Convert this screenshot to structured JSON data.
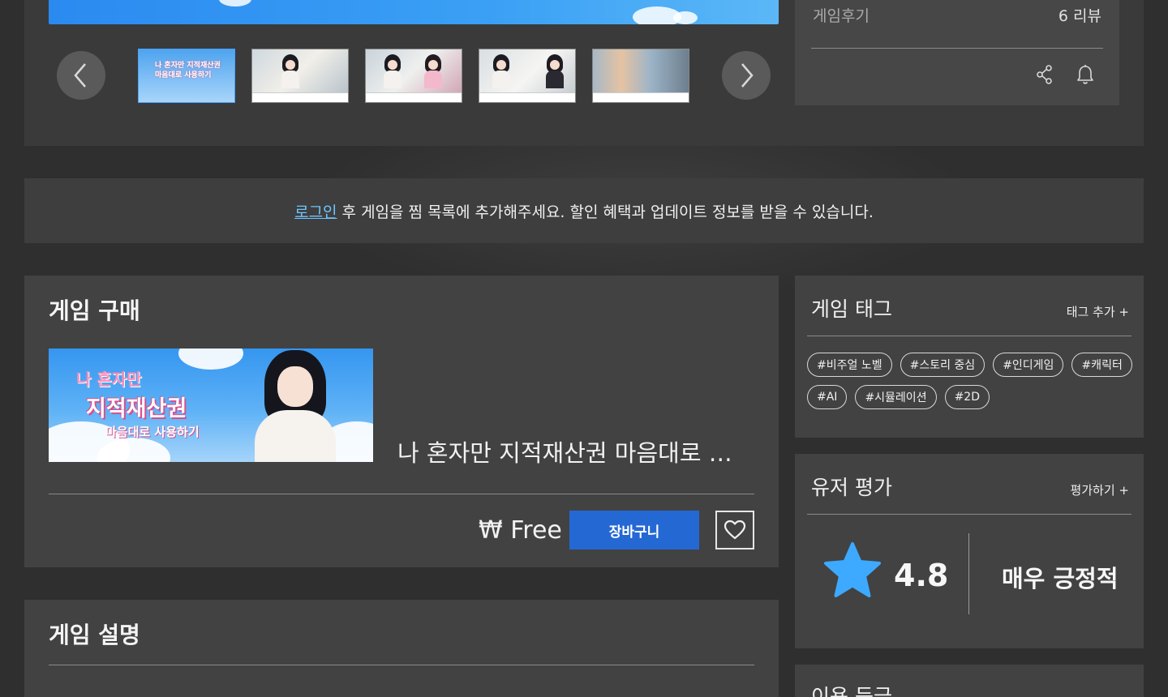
{
  "gallery": {
    "prev_icon": "chevron-left-icon",
    "next_icon": "chevron-right-icon",
    "prev_glyph": "‹",
    "next_glyph": "›",
    "thumbnails": [
      {
        "caption": "나 혼자만 지적재산권 마음대로 사용하기"
      },
      {
        "caption": "room-scene"
      },
      {
        "caption": "two-girls-scene"
      },
      {
        "caption": "dialogue-scene"
      },
      {
        "caption": "street-scene"
      }
    ]
  },
  "info": {
    "review_label": "게임후기",
    "review_count": "6 리뷰",
    "share_icon": "share-icon",
    "bell_icon": "bell-icon"
  },
  "login_banner": {
    "link_text": "로그인",
    "message": "후 게임을 찜 목록에 추가해주세요. 할인 혜택과 업데이트 정보를 받을 수 있습니다."
  },
  "purchase": {
    "title": "게임 구매",
    "banner_line1": "나 혼자만",
    "banner_line2": "지적재산권",
    "banner_line3": "마음대로 사용하기",
    "game_name": "나 혼자만 지적재산권 마음대로 사용하기",
    "price": "₩ Free",
    "cart_label": "장바구니",
    "wishlist_icon": "heart-icon"
  },
  "description": {
    "title": "게임 설명"
  },
  "tags": {
    "title": "게임 태그",
    "add_label": "태그 추가 +",
    "items": [
      "#비주얼 노벨",
      "#스토리 중심",
      "#인디게임",
      "#캐릭터",
      "#AI",
      "#시뮬레이션",
      "#2D"
    ]
  },
  "rating": {
    "title": "유저 평가",
    "rate_label": "평가하기 +",
    "score": "4.8",
    "verdict": "매우 긍정적",
    "star_icon": "star-icon",
    "star_color": "#3da9ff"
  },
  "age_rating": {
    "title": "이용 등급"
  },
  "colors": {
    "accent_blue": "#2468d4",
    "link_blue": "#6ec4ff"
  }
}
